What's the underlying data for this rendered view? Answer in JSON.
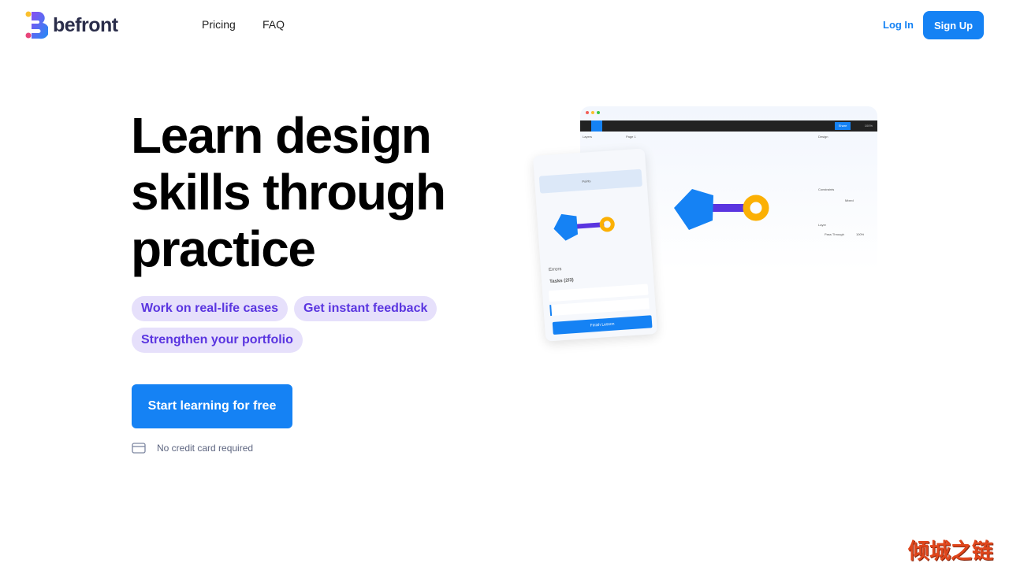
{
  "header": {
    "brand": "befront",
    "nav": [
      "Pricing",
      "FAQ"
    ],
    "login": "Log In",
    "signup": "Sign Up"
  },
  "hero": {
    "title_lines": [
      "Learn design",
      "skills through",
      "practice"
    ],
    "chips": [
      "Work on real-life cases",
      "Get instant feedback",
      "Strengthen your portfolio"
    ],
    "cta": "Start learning for free",
    "note": "No credit card required"
  },
  "illustration": {
    "toolbar_share": "Share",
    "zoom": "100%",
    "layers_tab": "Layers",
    "page": "Page 1",
    "design_tab": "Design",
    "constraints": "Constraints",
    "mixed": "Mixed",
    "layer": "Layer",
    "pass_through": "Pass Through",
    "opacity": "100%",
    "panel": {
      "points": "Points",
      "errors": "Errors",
      "tasks": "Tasks (2/3)",
      "finish": "Finish Lesson"
    },
    "colors": {
      "pentagon": "#1582f4",
      "connector": "#5a35e0",
      "ring": "#fbb004"
    }
  },
  "watermark": "倾城之链"
}
